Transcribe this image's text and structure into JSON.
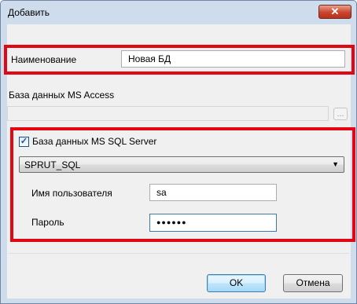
{
  "window": {
    "title": "Добавить",
    "close_glyph": "✕"
  },
  "name_row": {
    "label": "Наименование",
    "value": "Новая БД"
  },
  "access": {
    "label": "База данных MS Access",
    "value": "",
    "browse_label": "..."
  },
  "sql": {
    "checkbox_label": "База данных MS SQL Server",
    "checked": true,
    "server_selected": "SPRUT_SQL",
    "username_label": "Имя пользователя",
    "username_value": "sa",
    "password_label": "Пароль",
    "password_masked": "●●●●●●"
  },
  "buttons": {
    "ok": "OK",
    "cancel": "Отмена"
  },
  "colors": {
    "highlight": "#e30613",
    "title_bar": "#cfdcec",
    "client_bg": "#f0f0f0"
  }
}
